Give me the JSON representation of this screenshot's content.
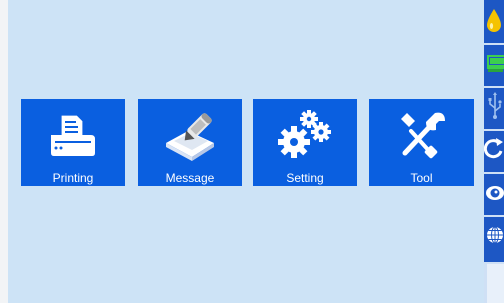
{
  "menu": {
    "printing_label": "Printing",
    "message_label": "Message",
    "setting_label": "Setting",
    "tool_label": "Tool"
  },
  "sidebar": {
    "icons": [
      "ink-drop-icon",
      "printer-status-icon",
      "usb-icon",
      "refresh-icon",
      "eye-icon",
      "globe-icon"
    ]
  },
  "colors": {
    "background": "#cde3f6",
    "tile": "#0a5fe0",
    "sidebar": "#1d57c4",
    "ink": "#f5c300",
    "status_green": "#3ccf4e"
  }
}
